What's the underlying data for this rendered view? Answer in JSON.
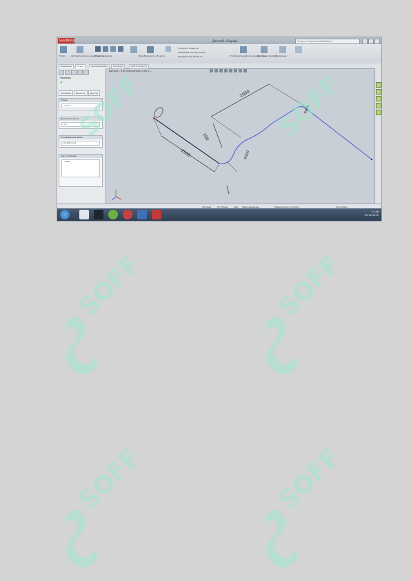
{
  "window": {
    "app_logo": "SolidWorks",
    "document_title": "Детали1 Сборка1",
    "search_placeholder": "Поиск в Справке SolidWorks"
  },
  "ribbon": {
    "labels": [
      "Эскиз",
      "Автоматическое нанесение размеров",
      "Объекты",
      "Преобразовать объекты",
      "Отобразить/удалить взаимосвязи",
      "Быстрые привязки",
      "Рисование",
      "Отразить объекты",
      "Линейный массив эскиза",
      "Переместить объекты"
    ]
  },
  "command_tabs": [
    "Элементы",
    "Эскиз",
    "Анализировать",
    "DimXpert",
    "Office Products"
  ],
  "panel": {
    "title": "Размеры",
    "tabs": [
      "Значение",
      "Выноски",
      "Другие"
    ],
    "sections": [
      {
        "header": "Стиль",
        "row": "<нет>"
      },
      {
        "header": "Допуск/Точность",
        "row": ".12"
      },
      {
        "header": "Основные значения",
        "row": "D1@Эскиз3"
      },
      {
        "header": "Текст размера",
        "row": "<DIM>"
      }
    ]
  },
  "viewport": {
    "tree_label": "Деталь1 (По умолчанию<<По у..."
  },
  "drawing": {
    "dims": [
      "2500",
      "2000",
      "100",
      "R500",
      "R800"
    ]
  },
  "statusbar": {
    "items": [
      "450.6мм",
      "227.53мм",
      "0мм",
      "Недоопределен",
      "Редактируется Эскиз3",
      "Настройка"
    ]
  },
  "taskbar": {
    "time": "11:46",
    "date": "03.12.2013"
  },
  "watermark": {
    "text": "SOFF"
  },
  "colors": {
    "sketch_blue": "#2a3bd6",
    "dimension": "#1a1a1a",
    "watermark": "#9ee8cc",
    "taskbar": "#34455a"
  }
}
